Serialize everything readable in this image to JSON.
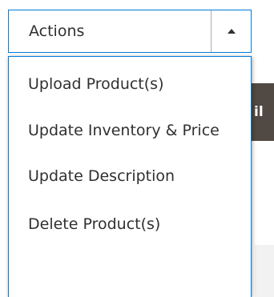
{
  "actions": {
    "toggle_label": "Actions",
    "arrow_icon": "triangle-up-icon",
    "menu_items": [
      {
        "label": "Upload Product(s)"
      },
      {
        "label": "Update Inventory & Price"
      },
      {
        "label": "Update Description"
      },
      {
        "label": "Delete Product(s)"
      }
    ]
  },
  "background": {
    "partial_button_text": "il"
  },
  "colors": {
    "accent_border": "#007bdb",
    "text": "#303030",
    "dark_button": "#514943"
  }
}
